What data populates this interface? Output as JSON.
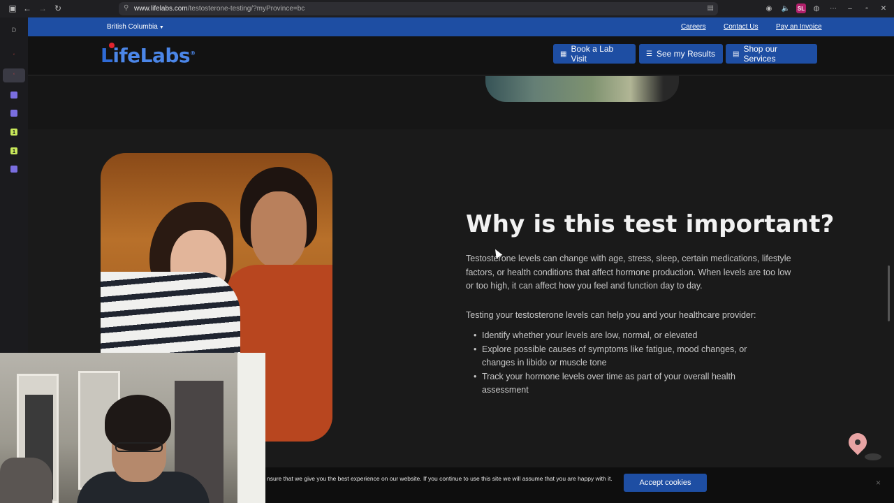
{
  "browser": {
    "url_host": "www.lifelabs.com",
    "url_path": "/testosterone-testing/?myProvince=bc",
    "extension_badge": "SL",
    "sidebar_letter": "D",
    "sidebar_tab_a": "1",
    "sidebar_tab_b": "1"
  },
  "utility_bar": {
    "province": "British Columbia",
    "links": [
      "Careers",
      "Contact Us",
      "Pay an Invoice"
    ]
  },
  "header": {
    "logo_text_1": "L",
    "logo_text_2": "ifeLabs",
    "buttons": [
      "Book a Lab Visit",
      "See my Results",
      "Shop our Services"
    ]
  },
  "section": {
    "heading": "Why is this test important?",
    "paragraph": "Testosterone levels can change with age, stress, sleep, certain medications, lifestyle factors, or health conditions that affect hormone production. When levels are too low or too high, it can affect how you feel and function day to day.",
    "intro": "Testing your testosterone levels can help you and your healthcare provider:",
    "bullets": [
      "Identify whether your levels are low, normal, or elevated",
      "Explore possible causes of symptoms like fatigue, mood changes, or changes in libido or muscle tone",
      "Track your hormone levels over time as part of your overall health assessment"
    ]
  },
  "cookie": {
    "text": "nsure that we give you the best experience on our website. If you continue to use this site we will assume that you are happy with it.",
    "button": "Accept cookies",
    "close": "×"
  },
  "colors": {
    "brand_blue": "#1e4ea3",
    "background": "#161616"
  }
}
